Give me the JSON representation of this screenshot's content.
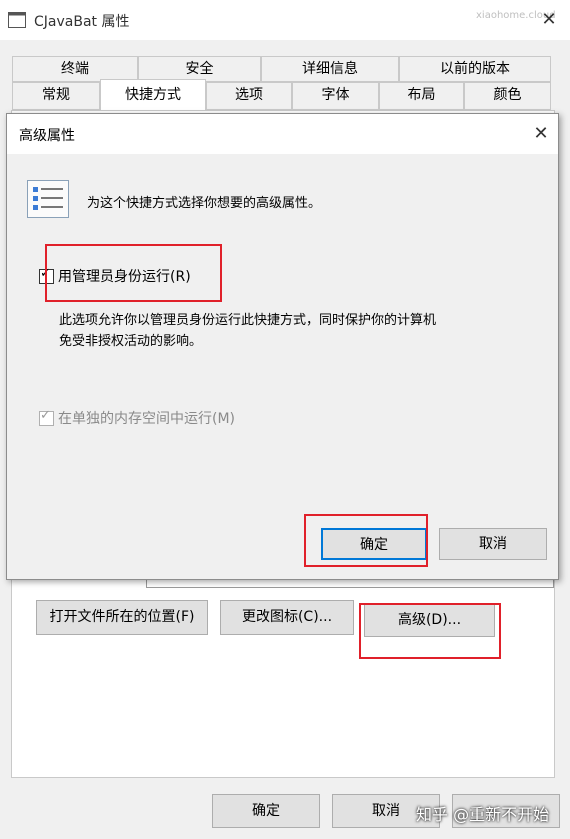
{
  "window": {
    "title": "CJavaBat 属性",
    "watermark": "xiaohome.cloud"
  },
  "tabs_row1": [
    "终端",
    "安全",
    "详细信息",
    "以前的版本"
  ],
  "tabs_row2": [
    "常规",
    "快捷方式",
    "选项",
    "字体",
    "布局",
    "颜色"
  ],
  "dialog": {
    "title": "高级属性",
    "description": "为这个快捷方式选择你想要的高级属性。",
    "run_as_admin_label": "用管理员身份运行(R)",
    "run_as_admin_checked": true,
    "info_line1": "此选项允许你以管理员身份运行此快捷方式，同时保护你的计算机",
    "info_line2": "免受非授权活动的影响。",
    "separate_memory_label": "在单独的内存空间中运行(M)",
    "separate_memory_checked": true,
    "ok_label": "确定",
    "cancel_label": "取消"
  },
  "shortcut_buttons": {
    "open_location": "打开文件所在的位置(F)",
    "change_icon": "更改图标(C)...",
    "advanced": "高级(D)..."
  },
  "bottom_buttons": {
    "ok": "确定",
    "cancel": "取消"
  },
  "footer_watermark": "知乎 @重新不开始"
}
